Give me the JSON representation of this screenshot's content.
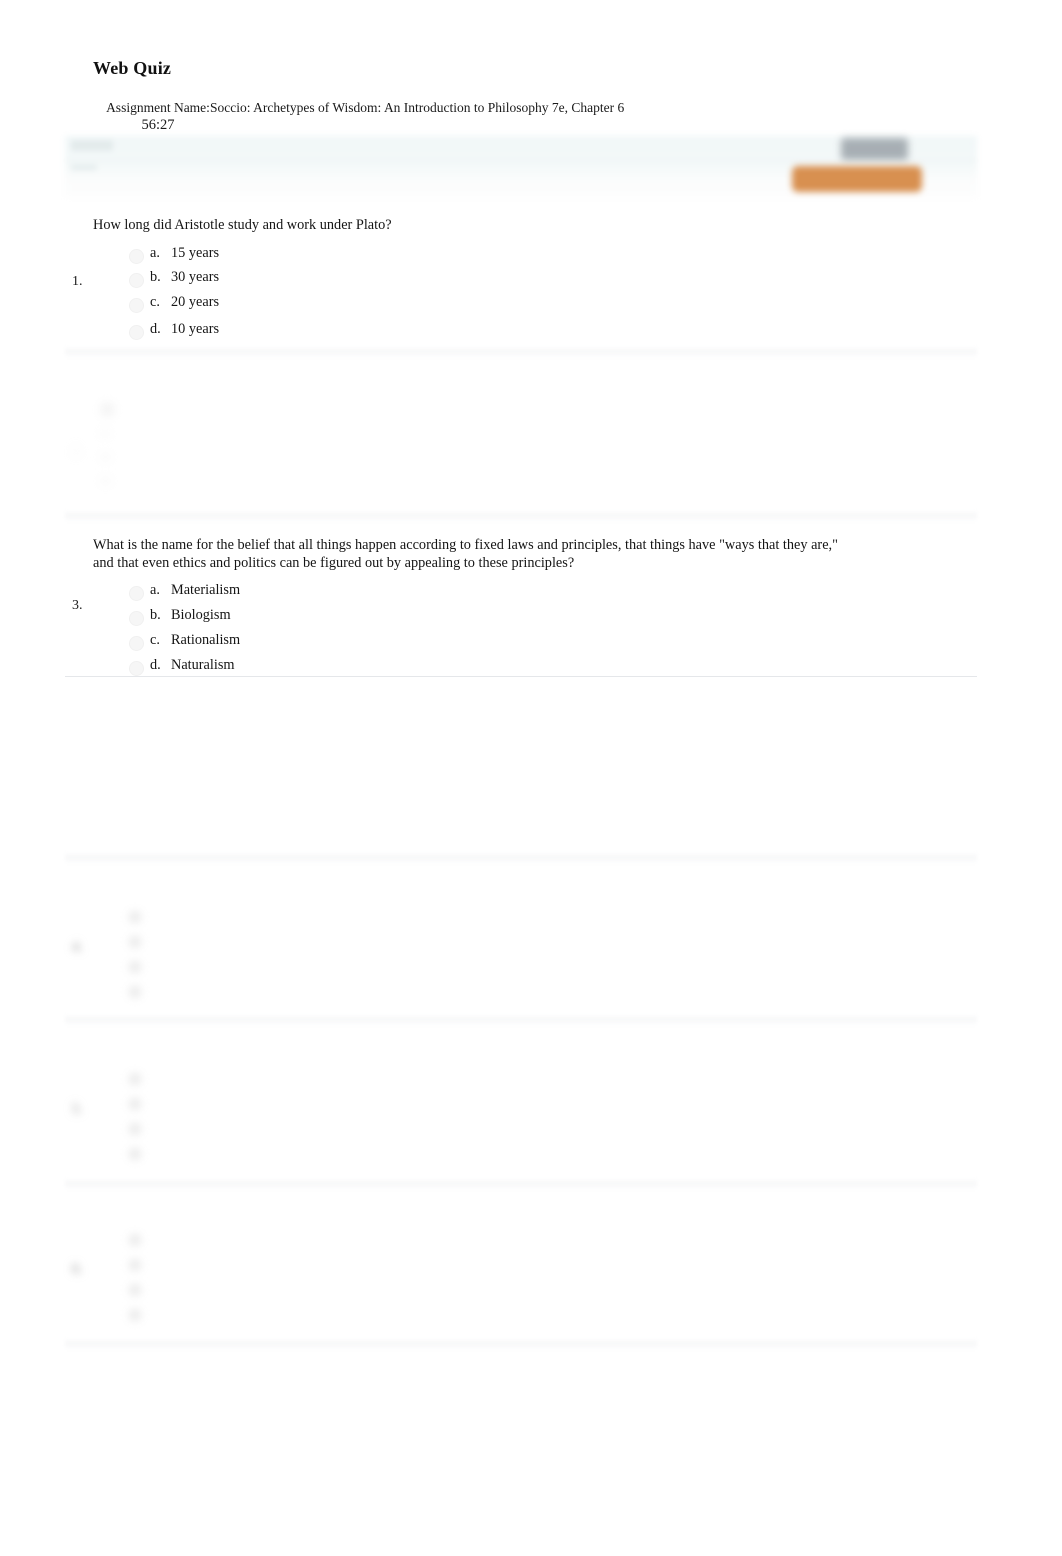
{
  "page": {
    "title": "Web Quiz"
  },
  "header": {
    "assignment_label": "Assignment Name:",
    "timer": "56:27",
    "assignment_value": "Soccio: Archetypes of Wisdom: An Introduction to Philosophy 7e, Chapter 6"
  },
  "toolbar": {
    "submit_label": "",
    "accent_color": "#d89050",
    "band_color": "#f2f7f8"
  },
  "questions": [
    {
      "number": "1.",
      "text": "How long did Aristotle study and work under Plato?",
      "options": [
        {
          "letter": "a.",
          "text": "15 years"
        },
        {
          "letter": "b.",
          "text": "30 years"
        },
        {
          "letter": "c.",
          "text": "20 years"
        },
        {
          "letter": "d.",
          "text": "10 years"
        }
      ]
    },
    {
      "number": "2.",
      "text": "",
      "options": [
        {
          "letter": "",
          "text": ""
        },
        {
          "letter": "",
          "text": ""
        },
        {
          "letter": "",
          "text": ""
        },
        {
          "letter": "",
          "text": ""
        }
      ]
    },
    {
      "number": "3.",
      "text": "What is the name for the belief that all things happen according to fixed laws and principles, that things have \"ways that they are,\" and that even ethics and politics can be figured out by appealing to these principles?",
      "text_line1": "What is the name for the belief that all things happen according to fixed laws and principles, that things have \"ways that they are,\"",
      "text_line2": "and that even ethics and politics can be figured out by appealing to these principles?",
      "options": [
        {
          "letter": "a.",
          "text": "Materialism"
        },
        {
          "letter": "b.",
          "text": "Biologism"
        },
        {
          "letter": "c.",
          "text": "Rationalism"
        },
        {
          "letter": "d.",
          "text": "Naturalism"
        }
      ]
    },
    {
      "number": "4.",
      "text": "",
      "options": [
        {
          "letter": "",
          "text": ""
        },
        {
          "letter": "",
          "text": ""
        },
        {
          "letter": "",
          "text": ""
        },
        {
          "letter": "",
          "text": ""
        }
      ]
    },
    {
      "number": "5.",
      "text": "",
      "options": [
        {
          "letter": "",
          "text": ""
        },
        {
          "letter": "",
          "text": ""
        },
        {
          "letter": "",
          "text": ""
        },
        {
          "letter": "",
          "text": ""
        }
      ]
    },
    {
      "number": "6.",
      "text": "",
      "options": [
        {
          "letter": "",
          "text": ""
        },
        {
          "letter": "",
          "text": ""
        },
        {
          "letter": "",
          "text": ""
        },
        {
          "letter": "",
          "text": ""
        }
      ]
    }
  ]
}
